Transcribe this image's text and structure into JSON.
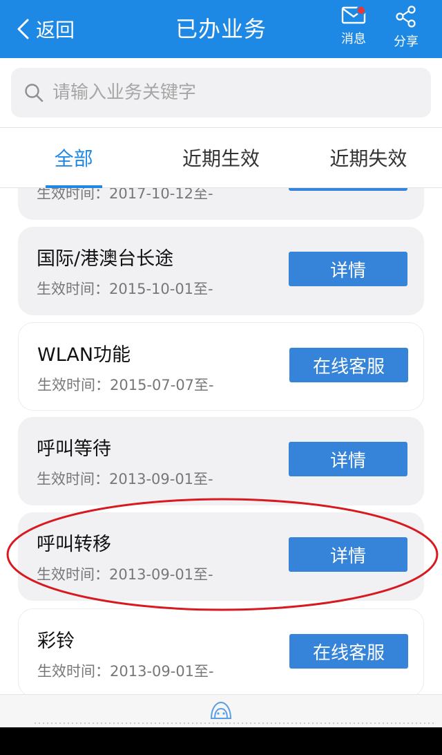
{
  "header": {
    "back_label": "返回",
    "title": "已办业务",
    "message_label": "消息",
    "share_label": "分享"
  },
  "search": {
    "placeholder": "请输入业务关键字"
  },
  "tabs": [
    {
      "label": "全部",
      "active": true
    },
    {
      "label": "近期生效",
      "active": false
    },
    {
      "label": "近期失效",
      "active": false
    }
  ],
  "services": [
    {
      "name": "",
      "date": "生效时间：2017-10-12至-",
      "button": ""
    },
    {
      "name": "国际/港澳台长途",
      "date": "生效时间：2015-10-01至-",
      "button": "详情"
    },
    {
      "name": "WLAN功能",
      "date": "生效时间：2015-07-07至-",
      "button": "在线客服"
    },
    {
      "name": "呼叫等待",
      "date": "生效时间：2013-09-01至-",
      "button": "详情"
    },
    {
      "name": "呼叫转移",
      "date": "生效时间：2013-09-01至-",
      "button": "详情"
    },
    {
      "name": "彩铃",
      "date": "生效时间：2013-09-01至-",
      "button": "在线客服"
    }
  ],
  "colors": {
    "brand_blue": "#1e88e5",
    "button_blue": "#3584d9",
    "badge_red": "#e53935",
    "annotation_red": "#d71920"
  }
}
